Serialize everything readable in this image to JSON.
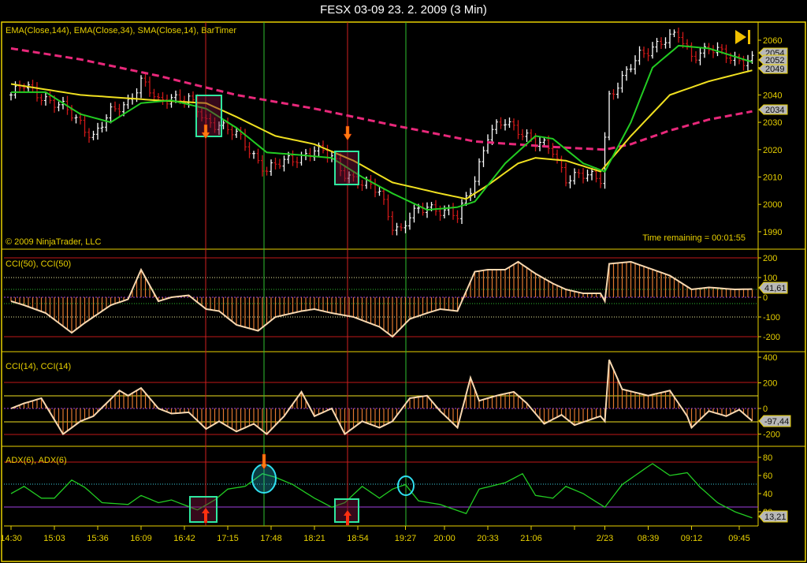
{
  "window": {
    "title": "FESX 03-09  23. 2. 2009 (3 Min)"
  },
  "overlay": {
    "price_panel_label": "EMA(Close,144), EMA(Close,34), SMA(Close,14), BarTimer",
    "copyright": "© 2009 NinjaTrader, LLC",
    "time_remaining": "Time remaining = 00:01:55",
    "cci50_label": "CCI(50), CCI(50)",
    "cci14_label": "CCI(14), CCI(14)",
    "adx_label": "ADX(6), ADX(6)"
  },
  "colors": {
    "ema144": "#e8287a",
    "ema34": "#f0e020",
    "sma14": "#22cc22",
    "axis": "#e8d000",
    "cci_hist": "#e07830",
    "cci_line": "#f8d8b0",
    "adx": "#22cc22"
  },
  "chart_data": {
    "type": "line",
    "instrument": "FESX 03-09",
    "interval": "3 Min",
    "x_ticks": [
      {
        "bar": 0,
        "label": "14:30"
      },
      {
        "bar": 10,
        "label": "15:03"
      },
      {
        "bar": 20,
        "label": "15:36"
      },
      {
        "bar": 30,
        "label": "16:09"
      },
      {
        "bar": 40,
        "label": "16:42"
      },
      {
        "bar": 50,
        "label": "17:15"
      },
      {
        "bar": 60,
        "label": "17:48"
      },
      {
        "bar": 70,
        "label": "18:21"
      },
      {
        "bar": 80,
        "label": "18:54"
      },
      {
        "bar": 91,
        "label": "19:27"
      },
      {
        "bar": 100,
        "label": "20:00"
      },
      {
        "bar": 110,
        "label": "20:33"
      },
      {
        "bar": 120,
        "label": "21:06"
      },
      {
        "bar": 130,
        "label": ""
      },
      {
        "bar": 137,
        "label": "2/23"
      },
      {
        "bar": 147,
        "label": "08:39"
      },
      {
        "bar": 157,
        "label": "09:12"
      },
      {
        "bar": 168,
        "label": "09:45"
      }
    ],
    "bars_count": 172,
    "price": {
      "ylim": [
        1987,
        2064
      ],
      "y_ticks": [
        2060,
        2050,
        2040,
        2030,
        2020,
        2010,
        2000,
        1990
      ],
      "y_tick_labels": [
        "2060",
        "",
        "2040",
        "2030",
        "2020",
        "2010",
        "2000",
        "1990"
      ],
      "last_value_tags": [
        "2054",
        "2052",
        "2049",
        "2034"
      ],
      "close_keypoints": [
        [
          0,
          2040
        ],
        [
          3,
          2043
        ],
        [
          7,
          2040
        ],
        [
          12,
          2035
        ],
        [
          16,
          2030
        ],
        [
          19,
          2025
        ],
        [
          23,
          2033
        ],
        [
          27,
          2038
        ],
        [
          30,
          2045
        ],
        [
          34,
          2037
        ],
        [
          37,
          2040
        ],
        [
          41,
          2038
        ],
        [
          45,
          2030
        ],
        [
          48,
          2030
        ],
        [
          52,
          2025
        ],
        [
          56,
          2018
        ],
        [
          59,
          2013
        ],
        [
          63,
          2015
        ],
        [
          67,
          2018
        ],
        [
          70,
          2020
        ],
        [
          74,
          2017
        ],
        [
          77,
          2012
        ],
        [
          81,
          2007
        ],
        [
          85,
          2005
        ],
        [
          88,
          1993
        ],
        [
          90,
          1990
        ],
        [
          92,
          1995
        ],
        [
          96,
          2000
        ],
        [
          99,
          1998
        ],
        [
          103,
          1995
        ],
        [
          107,
          2010
        ],
        [
          110,
          2025
        ],
        [
          114,
          2030
        ],
        [
          117,
          2028
        ],
        [
          121,
          2022
        ],
        [
          125,
          2020
        ],
        [
          128,
          2010
        ],
        [
          132,
          2010
        ],
        [
          136,
          2010
        ],
        [
          138,
          2040
        ],
        [
          141,
          2045
        ],
        [
          145,
          2055
        ],
        [
          148,
          2058
        ],
        [
          152,
          2060
        ],
        [
          154,
          2062
        ],
        [
          157,
          2055
        ],
        [
          161,
          2056
        ],
        [
          165,
          2055
        ],
        [
          168,
          2053
        ],
        [
          171,
          2052
        ]
      ],
      "series": [
        {
          "name": "EMA(Close,144)",
          "color": "#e8287a",
          "style": "dashed",
          "keypoints": [
            [
              0,
              2057
            ],
            [
              16,
              2053
            ],
            [
              34,
              2047
            ],
            [
              52,
              2040
            ],
            [
              70,
              2035
            ],
            [
              88,
              2029
            ],
            [
              107,
              2023
            ],
            [
              125,
              2021
            ],
            [
              137,
              2020
            ],
            [
              143,
              2022
            ],
            [
              152,
              2027
            ],
            [
              161,
              2031
            ],
            [
              171,
              2034
            ]
          ]
        },
        {
          "name": "EMA(Close,34)",
          "color": "#f0e020",
          "style": "solid",
          "keypoints": [
            [
              0,
              2044
            ],
            [
              16,
              2040
            ],
            [
              34,
              2038
            ],
            [
              45,
              2037
            ],
            [
              52,
              2032
            ],
            [
              61,
              2025
            ],
            [
              70,
              2022
            ],
            [
              79,
              2016
            ],
            [
              88,
              2008
            ],
            [
              99,
              2004
            ],
            [
              105,
              2002
            ],
            [
              110,
              2007
            ],
            [
              117,
              2015
            ],
            [
              121,
              2017
            ],
            [
              128,
              2016
            ],
            [
              136,
              2012
            ],
            [
              143,
              2025
            ],
            [
              152,
              2040
            ],
            [
              161,
              2045
            ],
            [
              171,
              2049
            ]
          ]
        },
        {
          "name": "SMA(Close,14)",
          "color": "#22cc22",
          "style": "solid",
          "keypoints": [
            [
              0,
              2041
            ],
            [
              8,
              2041
            ],
            [
              16,
              2033
            ],
            [
              23,
              2030
            ],
            [
              30,
              2037
            ],
            [
              37,
              2038
            ],
            [
              45,
              2035
            ],
            [
              52,
              2028
            ],
            [
              59,
              2019
            ],
            [
              67,
              2018
            ],
            [
              74,
              2017
            ],
            [
              81,
              2010
            ],
            [
              88,
              2004
            ],
            [
              96,
              1998
            ],
            [
              103,
              1999
            ],
            [
              107,
              2001
            ],
            [
              114,
              2015
            ],
            [
              121,
              2025
            ],
            [
              125,
              2024
            ],
            [
              132,
              2015
            ],
            [
              137,
              2012
            ],
            [
              143,
              2030
            ],
            [
              148,
              2050
            ],
            [
              154,
              2058
            ],
            [
              161,
              2057
            ],
            [
              171,
              2052
            ]
          ]
        }
      ]
    },
    "cci50": {
      "type": "bar+line",
      "ylim": [
        -230,
        215
      ],
      "y_ticks": [
        200,
        100,
        0,
        -100,
        -200
      ],
      "y_tick_labels": [
        "200",
        "100",
        "0",
        "-100",
        "-200"
      ],
      "last_value": "41,61",
      "keypoints": [
        [
          0,
          -20
        ],
        [
          3,
          -40
        ],
        [
          8,
          -80
        ],
        [
          14,
          -180
        ],
        [
          17,
          -130
        ],
        [
          23,
          -40
        ],
        [
          27,
          -10
        ],
        [
          30,
          140
        ],
        [
          34,
          -20
        ],
        [
          37,
          0
        ],
        [
          41,
          10
        ],
        [
          45,
          -60
        ],
        [
          48,
          -70
        ],
        [
          52,
          -140
        ],
        [
          57,
          -170
        ],
        [
          61,
          -100
        ],
        [
          67,
          -70
        ],
        [
          70,
          -60
        ],
        [
          74,
          -80
        ],
        [
          79,
          -100
        ],
        [
          85,
          -150
        ],
        [
          88,
          -200
        ],
        [
          92,
          -110
        ],
        [
          96,
          -80
        ],
        [
          99,
          -60
        ],
        [
          103,
          -70
        ],
        [
          107,
          130
        ],
        [
          110,
          140
        ],
        [
          114,
          140
        ],
        [
          117,
          180
        ],
        [
          121,
          120
        ],
        [
          125,
          70
        ],
        [
          128,
          40
        ],
        [
          132,
          20
        ],
        [
          136,
          20
        ],
        [
          137,
          -20
        ],
        [
          138,
          170
        ],
        [
          143,
          180
        ],
        [
          152,
          110
        ],
        [
          157,
          40
        ],
        [
          161,
          50
        ],
        [
          167,
          40
        ],
        [
          171,
          41.61
        ]
      ]
    },
    "cci14": {
      "type": "bar+line",
      "ylim": [
        -230,
        420
      ],
      "y_ticks": [
        400,
        200,
        0,
        -200
      ],
      "y_tick_labels": [
        "400",
        "200",
        "0",
        "-200"
      ],
      "last_value": "-97,44",
      "keypoints": [
        [
          0,
          0
        ],
        [
          3,
          40
        ],
        [
          7,
          80
        ],
        [
          12,
          -200
        ],
        [
          16,
          -100
        ],
        [
          19,
          -60
        ],
        [
          25,
          140
        ],
        [
          27,
          100
        ],
        [
          30,
          160
        ],
        [
          34,
          0
        ],
        [
          37,
          -40
        ],
        [
          41,
          -30
        ],
        [
          45,
          -160
        ],
        [
          48,
          -100
        ],
        [
          52,
          -180
        ],
        [
          56,
          -120
        ],
        [
          59,
          -200
        ],
        [
          63,
          -60
        ],
        [
          67,
          130
        ],
        [
          70,
          -60
        ],
        [
          74,
          0
        ],
        [
          77,
          -200
        ],
        [
          81,
          -100
        ],
        [
          85,
          -150
        ],
        [
          88,
          -100
        ],
        [
          92,
          80
        ],
        [
          96,
          100
        ],
        [
          99,
          -20
        ],
        [
          103,
          -150
        ],
        [
          106,
          240
        ],
        [
          108,
          60
        ],
        [
          112,
          100
        ],
        [
          116,
          130
        ],
        [
          119,
          40
        ],
        [
          123,
          -120
        ],
        [
          127,
          -50
        ],
        [
          130,
          -130
        ],
        [
          136,
          -60
        ],
        [
          137,
          -100
        ],
        [
          138,
          380
        ],
        [
          141,
          150
        ],
        [
          147,
          100
        ],
        [
          152,
          140
        ],
        [
          156,
          -60
        ],
        [
          157,
          -150
        ],
        [
          161,
          -20
        ],
        [
          165,
          -60
        ],
        [
          168,
          -10
        ],
        [
          171,
          -97.44
        ]
      ]
    },
    "adx6": {
      "type": "line",
      "ylim": [
        0,
        88
      ],
      "y_ticks": [
        80,
        60,
        40,
        20
      ],
      "y_tick_labels": [
        "80",
        "60",
        "40",
        "20"
      ],
      "last_value": "13,21",
      "keypoints": [
        [
          0,
          40
        ],
        [
          3,
          48
        ],
        [
          7,
          35
        ],
        [
          10,
          35
        ],
        [
          14,
          55
        ],
        [
          17,
          47
        ],
        [
          21,
          30
        ],
        [
          27,
          28
        ],
        [
          30,
          38
        ],
        [
          34,
          30
        ],
        [
          37,
          33
        ],
        [
          43,
          22
        ],
        [
          47,
          33
        ],
        [
          50,
          45
        ],
        [
          54,
          48
        ],
        [
          58,
          62
        ],
        [
          61,
          58
        ],
        [
          65,
          50
        ],
        [
          70,
          35
        ],
        [
          74,
          25
        ],
        [
          77,
          30
        ],
        [
          81,
          48
        ],
        [
          85,
          35
        ],
        [
          88,
          45
        ],
        [
          91,
          50
        ],
        [
          94,
          32
        ],
        [
          99,
          28
        ],
        [
          105,
          18
        ],
        [
          108,
          45
        ],
        [
          114,
          52
        ],
        [
          118,
          62
        ],
        [
          121,
          38
        ],
        [
          125,
          35
        ],
        [
          128,
          48
        ],
        [
          132,
          40
        ],
        [
          137,
          25
        ],
        [
          141,
          50
        ],
        [
          147,
          70
        ],
        [
          148,
          73
        ],
        [
          152,
          60
        ],
        [
          156,
          63
        ],
        [
          159,
          47
        ],
        [
          163,
          30
        ],
        [
          167,
          20
        ],
        [
          171,
          13.21
        ]
      ]
    }
  }
}
